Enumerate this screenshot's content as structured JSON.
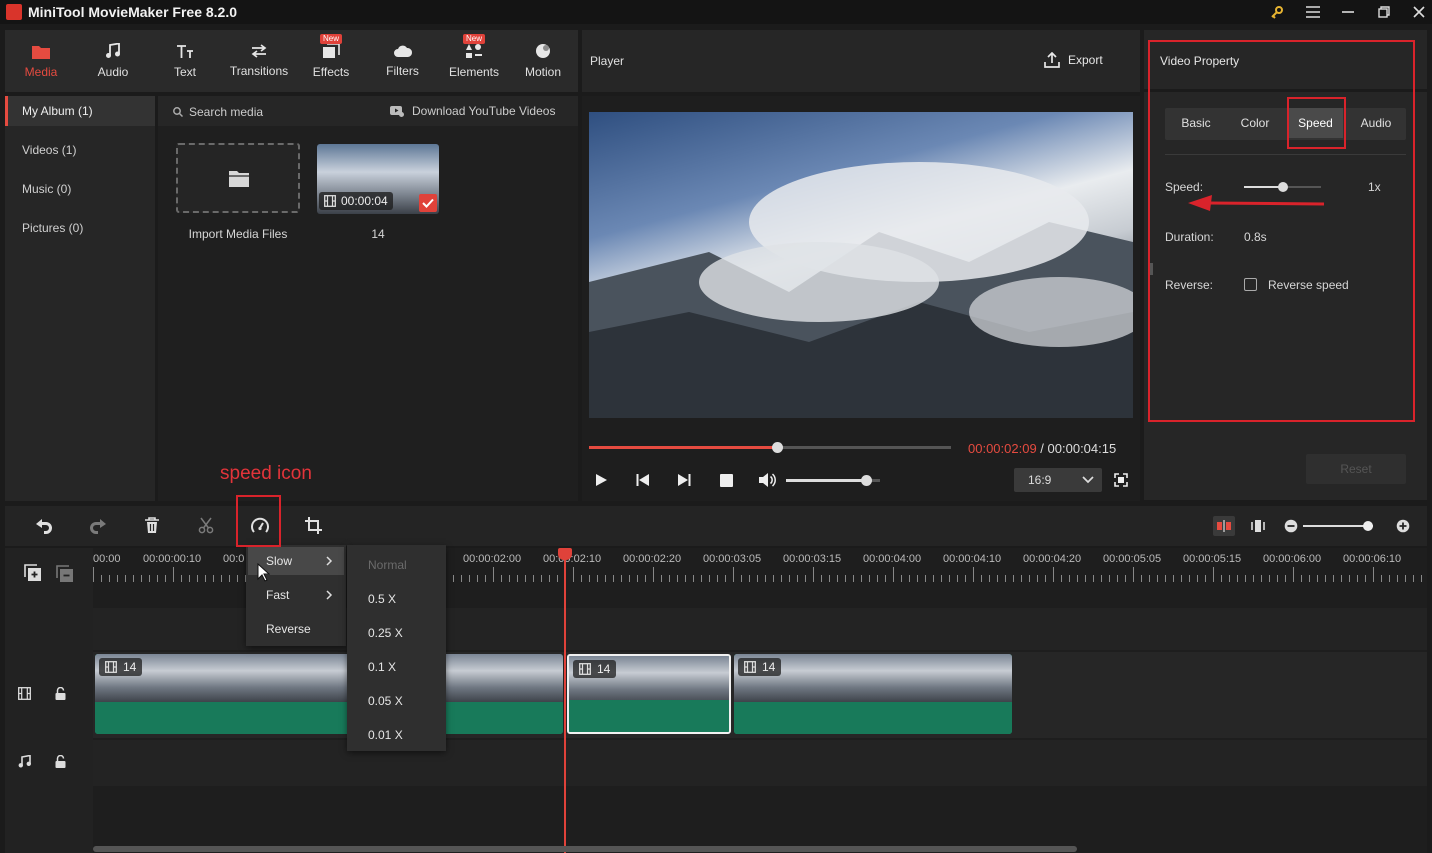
{
  "app": {
    "title": "MiniTool MovieMaker Free 8.2.0"
  },
  "library": {
    "tools": [
      {
        "label": "Media"
      },
      {
        "label": "Audio"
      },
      {
        "label": "Text"
      },
      {
        "label": "Transitions"
      },
      {
        "label": "Effects",
        "badge": "New"
      },
      {
        "label": "Filters"
      },
      {
        "label": "Elements",
        "badge": "New"
      },
      {
        "label": "Motion"
      }
    ],
    "side": [
      {
        "label": "My Album (1)"
      },
      {
        "label": "Videos (1)"
      },
      {
        "label": "Music (0)"
      },
      {
        "label": "Pictures (0)"
      }
    ],
    "search_label": "Search media",
    "download_label": "Download YouTube Videos",
    "import_label": "Import Media Files",
    "media_item": {
      "name": "14",
      "duration": "00:00:04"
    }
  },
  "player": {
    "title": "Player",
    "export_label": "Export",
    "time_current": "00:00:02:09",
    "time_separator": " / ",
    "time_total": "00:00:04:15",
    "aspect": "16:9",
    "progress": 0.52,
    "volume": 0.85
  },
  "property": {
    "title": "Video Property",
    "tabs": [
      "Basic",
      "Color",
      "Speed",
      "Audio"
    ],
    "active_tab": "Speed",
    "speed_label": "Speed:",
    "speed_value": "1x",
    "speed_slider": 0.5,
    "duration_label": "Duration:",
    "duration_value": "0.8s",
    "reverse_label": "Reverse:",
    "reverse_checkbox": "Reverse speed",
    "reset_label": "Reset"
  },
  "annotation": {
    "speed_icon": "speed icon"
  },
  "timeline": {
    "ticks": [
      "00:00",
      "00:00:00:10",
      "00:0",
      "00:00:02:00",
      "00:00:02:10",
      "00:00:02:20",
      "00:00:03:05",
      "00:00:03:15",
      "00:00:04:00",
      "00:00:04:10",
      "00:00:04:20",
      "00:00:05:05",
      "00:00:05:15",
      "00:00:06:00",
      "00:00:06:10"
    ],
    "clip_label": "14"
  },
  "speed_menu": {
    "items": [
      "Slow",
      "Fast",
      "Reverse"
    ],
    "slow_options": [
      "Normal",
      "0.5 X",
      "0.25 X",
      "0.1 X",
      "0.05 X",
      "0.01 X"
    ]
  },
  "colors": {
    "accent": "#e54b40",
    "annotation": "#d9232b",
    "clip": "#1ea77a"
  }
}
